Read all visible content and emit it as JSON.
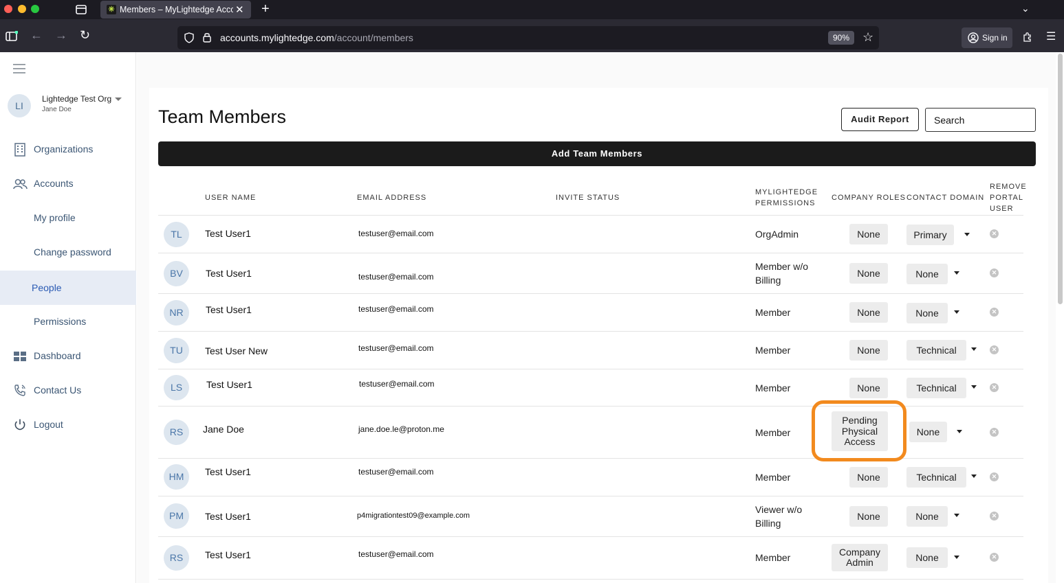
{
  "browser": {
    "tab_title": "Members – MyLightedge Accou",
    "url_host": "accounts.mylightedge.com",
    "url_path": "/account/members",
    "zoom": "90%",
    "sign_in": "Sign in"
  },
  "sidebar": {
    "org_initials": "LI",
    "org_name": "Lightedge Test Org",
    "org_user": "Jane Doe",
    "items": [
      {
        "label": "Organizations",
        "icon": "building-icon"
      },
      {
        "label": "Accounts",
        "icon": "users-icon"
      },
      {
        "label": "My profile"
      },
      {
        "label": "Change password"
      },
      {
        "label": "People",
        "active": true
      },
      {
        "label": "Permissions"
      },
      {
        "label": "Dashboard",
        "icon": "dashboard-icon"
      },
      {
        "label": "Contact Us",
        "icon": "phone-icon"
      },
      {
        "label": "Logout",
        "icon": "power-icon"
      }
    ]
  },
  "main": {
    "title": "Team Members",
    "audit_label": "Audit Report",
    "search_placeholder": "Search",
    "add_label": "Add Team Members",
    "columns": {
      "user_name": "USER NAME",
      "email": "EMAIL ADDRESS",
      "invite_status": "INVITE STATUS",
      "permissions_l1": "MYLIGHTEDGE",
      "permissions_l2": "PERMISSIONS",
      "company_roles": "COMPANY ROLES",
      "contact_domain": "CONTACT DOMAIN",
      "remove_l1": "REMOVE",
      "remove_l2": "PORTAL",
      "remove_l3": "USER"
    },
    "rows": [
      {
        "initials": "TL",
        "name": "Test User1",
        "email": "testuser@email.com",
        "permission_l1": "OrgAdmin",
        "permission_l2": "",
        "role_l1": "None",
        "role_l2": "",
        "role_l3": "",
        "domain": "Primary"
      },
      {
        "initials": "BV",
        "name": "Test User1",
        "email": "testuser@email.com",
        "permission_l1": "Member w/o",
        "permission_l2": "Billing",
        "role_l1": "None",
        "role_l2": "",
        "role_l3": "",
        "domain": "None"
      },
      {
        "initials": "NR",
        "name": "Test User1",
        "email": "testuser@email.com",
        "permission_l1": "Member",
        "permission_l2": "",
        "role_l1": "None",
        "role_l2": "",
        "role_l3": "",
        "domain": "None"
      },
      {
        "initials": "TU",
        "name": "Test User New",
        "email": "testuser@email.com",
        "permission_l1": "Member",
        "permission_l2": "",
        "role_l1": "None",
        "role_l2": "",
        "role_l3": "",
        "domain": "Technical"
      },
      {
        "initials": "LS",
        "name": "Test User1",
        "email": "testuser@email.com",
        "permission_l1": "Member",
        "permission_l2": "",
        "role_l1": "None",
        "role_l2": "",
        "role_l3": "",
        "domain": "Technical"
      },
      {
        "initials": "RS",
        "name": "Jane Doe",
        "email": "jane.doe.le@proton.me",
        "permission_l1": "Member",
        "permission_l2": "",
        "role_l1": "Pending",
        "role_l2": "Physical",
        "role_l3": "Access",
        "domain": "None"
      },
      {
        "initials": "HM",
        "name": "Test User1",
        "email": "testuser@email.com",
        "permission_l1": "Member",
        "permission_l2": "",
        "role_l1": "None",
        "role_l2": "",
        "role_l3": "",
        "domain": "Technical"
      },
      {
        "initials": "PM",
        "name": "Test User1",
        "email": "p4migrationtest09@example.com",
        "permission_l1": "Viewer w/o",
        "permission_l2": "Billing",
        "role_l1": "None",
        "role_l2": "",
        "role_l3": "",
        "domain": "None"
      },
      {
        "initials": "RS",
        "name": "Test User1",
        "email": "testuser@email.com",
        "permission_l1": "Member",
        "permission_l2": "",
        "role_l1": "Company",
        "role_l2": "Admin",
        "role_l3": "",
        "domain": "None"
      }
    ]
  }
}
